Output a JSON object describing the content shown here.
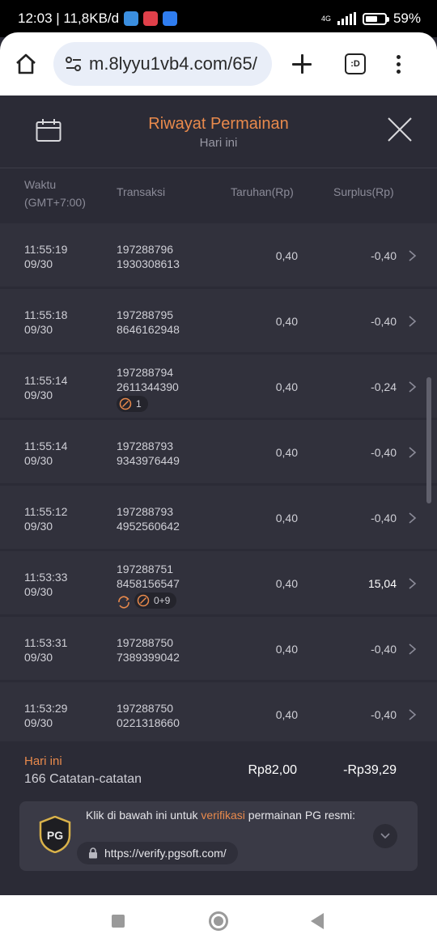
{
  "status_bar": {
    "time_info": "12:03 | 11,8KB/d",
    "network": "4G",
    "battery": "59%"
  },
  "browser": {
    "url": "m.8lyyu1vb4.com/65/",
    "tabs_label": ":D"
  },
  "header": {
    "title": "Riwayat Permainan",
    "subtitle": "Hari ini"
  },
  "columns": {
    "time": "Waktu",
    "time_zone": "(GMT+7:00)",
    "transaction": "Transaksi",
    "bet": "Taruhan(Rp)",
    "surplus": "Surplus(Rp)"
  },
  "rows": [
    {
      "time": "11:55:19",
      "date": "09/30",
      "txn1": "197288796",
      "txn2": "1930308613",
      "bet": "0,40",
      "surplus": "-0,40"
    },
    {
      "time": "11:55:18",
      "date": "09/30",
      "txn1": "197288795",
      "txn2": "8646162948",
      "bet": "0,40",
      "surplus": "-0,40"
    },
    {
      "time": "11:55:14",
      "date": "09/30",
      "txn1": "197288794",
      "txn2": "2611344390",
      "badge": "1",
      "bet": "0,40",
      "surplus": "-0,24"
    },
    {
      "time": "11:55:14",
      "date": "09/30",
      "txn1": "197288793",
      "txn2": "9343976449",
      "bet": "0,40",
      "surplus": "-0,40"
    },
    {
      "time": "11:55:12",
      "date": "09/30",
      "txn1": "197288793",
      "txn2": "4952560642",
      "bet": "0,40",
      "surplus": "-0,40"
    },
    {
      "time": "11:53:33",
      "date": "09/30",
      "txn1": "197288751",
      "txn2": "8458156547",
      "badge": "0+9",
      "bet": "0,40",
      "surplus": "15,04"
    },
    {
      "time": "11:53:31",
      "date": "09/30",
      "txn1": "197288750",
      "txn2": "7389399042",
      "bet": "0,40",
      "surplus": "-0,40"
    },
    {
      "time": "11:53:29",
      "date": "09/30",
      "txn1": "197288750",
      "txn2": "0221318660",
      "bet": "0,40",
      "surplus": "-0,40"
    }
  ],
  "summary": {
    "label": "Hari ini",
    "count": "166 Catatan-catatan",
    "total_bet": "Rp82,00",
    "total_surplus": "-Rp39,29"
  },
  "verify": {
    "text_before": "Klik di bawah ini untuk ",
    "text_highlight": "verifikasi",
    "text_after": " permainan PG resmi:",
    "link": "https://verify.pgsoft.com/",
    "logo_text": "PG"
  },
  "colors": {
    "accent": "#e98a4c",
    "background": "#2b2b36",
    "row": "#31313c"
  }
}
